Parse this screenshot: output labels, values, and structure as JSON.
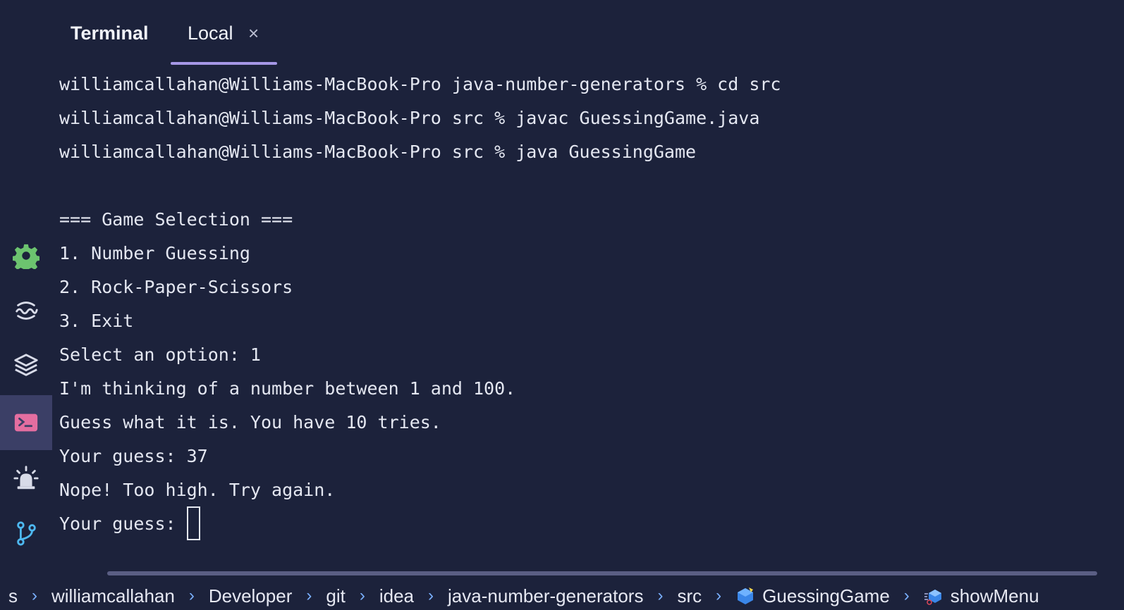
{
  "tabs": {
    "title": "Terminal",
    "active_tab": "Local",
    "close_symbol": "×"
  },
  "terminal": {
    "lines": [
      "williamcallahan@Williams-MacBook-Pro java-number-generators % cd src",
      "williamcallahan@Williams-MacBook-Pro src % javac GuessingGame.java",
      "williamcallahan@Williams-MacBook-Pro src % java GuessingGame",
      "",
      "=== Game Selection ===",
      "1. Number Guessing",
      "2. Rock-Paper-Scissors",
      "3. Exit",
      "Select an option: 1",
      "I'm thinking of a number between 1 and 100.",
      "Guess what it is. You have 10 tries.",
      "Your guess: 37",
      "Nope! Too high. Try again.",
      "Your guess: "
    ]
  },
  "toolstrip": {
    "items": [
      {
        "icon": "gear-icon",
        "color": "#6cc36f"
      },
      {
        "icon": "wave-icon",
        "color": "#d8dbe8"
      },
      {
        "icon": "layers-icon",
        "color": "#d8dbe8"
      },
      {
        "icon": "terminal-icon",
        "color": "#e46ea0",
        "active": true
      },
      {
        "icon": "alarm-icon",
        "color": "#d8dbe8"
      },
      {
        "icon": "git-branch-icon",
        "color": "#4db8f0"
      }
    ]
  },
  "breadcrumb": {
    "items": [
      "s",
      "williamcallahan",
      "Developer",
      "git",
      "idea",
      "java-number-generators",
      "src",
      "GuessingGame",
      "showMenu"
    ]
  },
  "colors": {
    "background": "#1c223b",
    "accent_underline": "#a597e6",
    "breadcrumb_separator": "#7ab0ff"
  }
}
